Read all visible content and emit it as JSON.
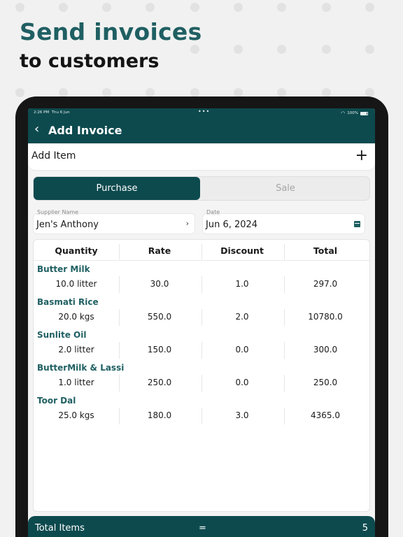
{
  "hero": {
    "title": "Send invoices",
    "subtitle": "to customers"
  },
  "status_bar": {
    "time": "2:26 PM",
    "date": "Thu 6 Jun",
    "more": "•••",
    "battery": "100%"
  },
  "header": {
    "back_icon": "‹",
    "title": "Add Invoice"
  },
  "add_item": {
    "label": "Add Item",
    "plus_icon": "+"
  },
  "segments": {
    "purchase": "Purchase",
    "sale": "Sale",
    "selected": "Purchase"
  },
  "supplier": {
    "label": "Supplier Name",
    "value": "Jen's Anthony",
    "chevron_icon": "›"
  },
  "date": {
    "label": "Date",
    "value": "Jun 6, 2024"
  },
  "table": {
    "headers": [
      "Quantity",
      "Rate",
      "Discount",
      "Total"
    ],
    "rows": [
      {
        "name": "Butter Milk",
        "quantity": "10.0 litter",
        "rate": "30.0",
        "discount": "1.0",
        "total": "297.0"
      },
      {
        "name": "Basmati Rice",
        "quantity": "20.0 kgs",
        "rate": "550.0",
        "discount": "2.0",
        "total": "10780.0"
      },
      {
        "name": "Sunlite Oil",
        "quantity": "2.0 litter",
        "rate": "150.0",
        "discount": "0.0",
        "total": "300.0"
      },
      {
        "name": "ButterMilk & Lassi",
        "quantity": "1.0 litter",
        "rate": "250.0",
        "discount": "0.0",
        "total": "250.0"
      },
      {
        "name": "Toor Dal",
        "quantity": "25.0 kgs",
        "rate": "180.0",
        "discount": "3.0",
        "total": "4365.0"
      }
    ]
  },
  "footer": {
    "label": "Total Items",
    "equals": "=",
    "value": "5"
  },
  "colors": {
    "brand": "#0d4a4e",
    "accent_text": "#1f5f62"
  }
}
